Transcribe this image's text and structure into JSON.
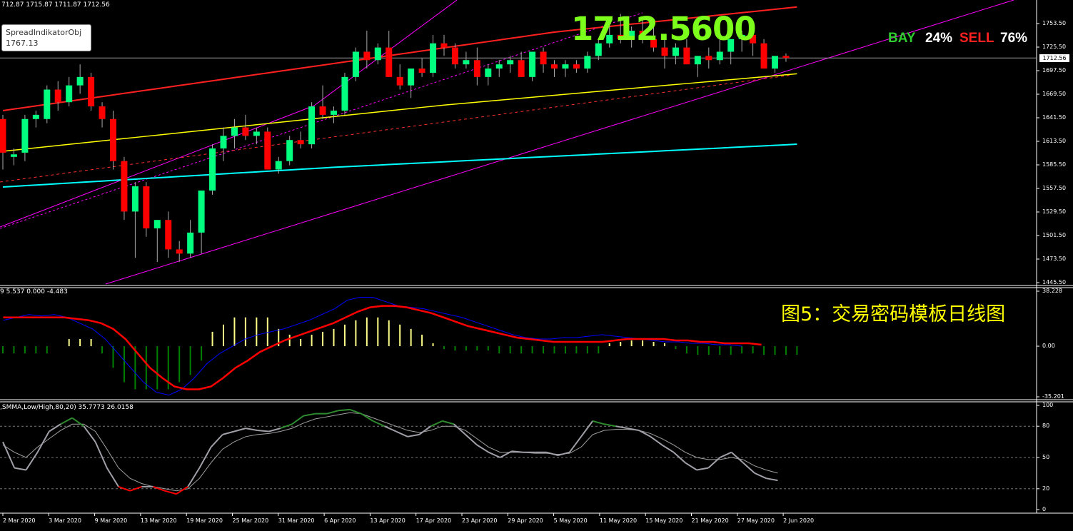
{
  "header": {
    "ohlc_text": "712.87 1715.87 1711.87 1712.56",
    "object_name": "SpreadIndikatorObj",
    "object_value": "1767.13",
    "big_price": "1712.5600",
    "bay_label": "BAY",
    "bay_pct": "24%",
    "sell_label": "SELL",
    "sell_pct": "76%",
    "current_price_tag": "1712.56",
    "figure_title": "图5：交易密码模板日线图"
  },
  "colors": {
    "background": "#000000",
    "bull_candle": "#00ff7f",
    "bear_candle": "#ff0000",
    "ma_yellow": "#ffff00",
    "ma_cyan": "#00ffff",
    "ma_red": "#ff2020",
    "channel": "#ff00ff",
    "macd_line": "#ff0000",
    "signal_line": "#0000ff",
    "hist_pos": "#ffff88",
    "hist_neg": "#008000",
    "stoch_main": "#a0a0a8",
    "stoch_signal": "#a0a0a0",
    "stoch_overbought": "#2e8b2e",
    "stoch_oversold": "#ff0000"
  },
  "chart_data": [
    {
      "type": "candlestick",
      "x_labels": [
        "2 Mar 2020",
        "3 Mar 2020",
        "9 Mar 2020",
        "13 Mar 2020",
        "19 Mar 2020",
        "25 Mar 2020",
        "31 Mar 2020",
        "6 Apr 2020",
        "13 Apr 2020",
        "17 Apr 2020",
        "23 Apr 2020",
        "29 Apr 2020",
        "5 May 2020",
        "11 May 2020",
        "15 May 2020",
        "21 May 2020",
        "27 May 2020",
        "2 Jun 2020"
      ],
      "y_ticks": [
        "1753.50",
        "1725.50",
        "1697.50",
        "1669.50",
        "1641.50",
        "1613.50",
        "1585.50",
        "1557.50",
        "1529.50",
        "1501.50",
        "1473.50",
        "1445.50"
      ],
      "ylim": [
        1445.5,
        1778
      ],
      "candles": [
        [
          1640,
          1645,
          1580,
          1600
        ],
        [
          1595,
          1605,
          1585,
          1598
        ],
        [
          1600,
          1645,
          1590,
          1640
        ],
        [
          1640,
          1650,
          1630,
          1645
        ],
        [
          1640,
          1680,
          1635,
          1675
        ],
        [
          1675,
          1685,
          1650,
          1660
        ],
        [
          1660,
          1690,
          1655,
          1680
        ],
        [
          1680,
          1705,
          1670,
          1690
        ],
        [
          1690,
          1695,
          1650,
          1655
        ],
        [
          1655,
          1660,
          1630,
          1640
        ],
        [
          1640,
          1650,
          1580,
          1590
        ],
        [
          1590,
          1595,
          1520,
          1530
        ],
        [
          1530,
          1565,
          1475,
          1560
        ],
        [
          1560,
          1565,
          1500,
          1510
        ],
        [
          1510,
          1520,
          1470,
          1520
        ],
        [
          1520,
          1530,
          1475,
          1485
        ],
        [
          1485,
          1495,
          1470,
          1480
        ],
        [
          1480,
          1520,
          1475,
          1505
        ],
        [
          1505,
          1525,
          1480,
          1555
        ],
        [
          1555,
          1610,
          1550,
          1605
        ],
        [
          1605,
          1630,
          1590,
          1620
        ],
        [
          1620,
          1640,
          1605,
          1630
        ],
        [
          1630,
          1645,
          1615,
          1620
        ],
        [
          1620,
          1630,
          1610,
          1625
        ],
        [
          1625,
          1630,
          1580,
          1580
        ],
        [
          1580,
          1595,
          1575,
          1590
        ],
        [
          1590,
          1620,
          1585,
          1615
        ],
        [
          1615,
          1625,
          1605,
          1610
        ],
        [
          1610,
          1660,
          1605,
          1655
        ],
        [
          1655,
          1680,
          1640,
          1645
        ],
        [
          1645,
          1655,
          1635,
          1650
        ],
        [
          1650,
          1695,
          1645,
          1690
        ],
        [
          1690,
          1725,
          1685,
          1720
        ],
        [
          1720,
          1745,
          1700,
          1710
        ],
        [
          1710,
          1730,
          1705,
          1725
        ],
        [
          1725,
          1745,
          1690,
          1690
        ],
        [
          1690,
          1705,
          1675,
          1680
        ],
        [
          1680,
          1700,
          1665,
          1700
        ],
        [
          1700,
          1712,
          1690,
          1695
        ],
        [
          1695,
          1740,
          1690,
          1730
        ],
        [
          1730,
          1740,
          1715,
          1725
        ],
        [
          1725,
          1730,
          1700,
          1705
        ],
        [
          1705,
          1720,
          1700,
          1710
        ],
        [
          1710,
          1725,
          1680,
          1690
        ],
        [
          1690,
          1705,
          1680,
          1700
        ],
        [
          1700,
          1710,
          1690,
          1705
        ],
        [
          1705,
          1715,
          1695,
          1710
        ],
        [
          1710,
          1720,
          1690,
          1690
        ],
        [
          1690,
          1720,
          1685,
          1720
        ],
        [
          1720,
          1725,
          1695,
          1705
        ],
        [
          1705,
          1710,
          1690,
          1700
        ],
        [
          1700,
          1710,
          1690,
          1705
        ],
        [
          1705,
          1710,
          1695,
          1700
        ],
        [
          1700,
          1720,
          1695,
          1715
        ],
        [
          1715,
          1735,
          1710,
          1730
        ],
        [
          1730,
          1750,
          1725,
          1740
        ],
        [
          1740,
          1765,
          1730,
          1735
        ],
        [
          1735,
          1750,
          1725,
          1745
        ],
        [
          1745,
          1760,
          1730,
          1735
        ],
        [
          1735,
          1755,
          1720,
          1725
        ],
        [
          1725,
          1735,
          1700,
          1715
        ],
        [
          1715,
          1730,
          1705,
          1725
        ],
        [
          1725,
          1735,
          1705,
          1705
        ],
        [
          1705,
          1715,
          1690,
          1715
        ],
        [
          1715,
          1725,
          1700,
          1710
        ],
        [
          1710,
          1740,
          1705,
          1720
        ],
        [
          1720,
          1735,
          1705,
          1735
        ],
        [
          1735,
          1745,
          1720,
          1740
        ],
        [
          1740,
          1745,
          1715,
          1730
        ],
        [
          1730,
          1735,
          1700,
          1700
        ],
        [
          1700,
          1715,
          1695,
          1715
        ],
        [
          1715,
          1718,
          1708,
          1712.56
        ]
      ]
    },
    {
      "type": "line",
      "name": "MACD",
      "y_ticks": [
        "38.228",
        "0.00",
        "-35.201"
      ],
      "ylim": [
        -35.201,
        38.228
      ],
      "header_text": "9 5.537 0.000 -4.483",
      "macd_line": [
        20,
        20,
        20,
        20,
        20,
        20,
        19,
        18,
        16,
        12,
        5,
        -5,
        -15,
        -22,
        -28,
        -30,
        -30,
        -28,
        -22,
        -15,
        -10,
        -4,
        0,
        4,
        7,
        10,
        13,
        16,
        20,
        24,
        27,
        28,
        28,
        27,
        25,
        23,
        20,
        17,
        14,
        12,
        10,
        8,
        6,
        5,
        4,
        3,
        3,
        3,
        3,
        3,
        4,
        5,
        5,
        5,
        5,
        4,
        4,
        3,
        3,
        2,
        2,
        2,
        1
      ],
      "signal_line": [
        18,
        20,
        22,
        21,
        22,
        20,
        16,
        12,
        5,
        -5,
        -15,
        -25,
        -32,
        -34,
        -30,
        -22,
        -12,
        -5,
        0,
        5,
        8,
        10,
        12,
        15,
        18,
        22,
        26,
        32,
        34,
        34,
        31,
        28,
        27,
        26,
        24,
        22,
        20,
        17,
        14,
        11,
        8,
        6,
        5,
        5,
        6,
        6,
        7,
        8,
        7,
        6,
        5,
        4,
        3,
        3,
        2,
        2,
        1,
        1,
        0
      ],
      "histogram": [
        -5,
        -5,
        -5,
        -5,
        -5,
        0,
        5,
        5,
        5,
        -5,
        -15,
        -25,
        -30,
        -30,
        -30,
        -30,
        -25,
        -20,
        -10,
        10,
        15,
        20,
        20,
        20,
        20,
        12,
        8,
        5,
        8,
        10,
        12,
        15,
        18,
        20,
        20,
        18,
        15,
        12,
        8,
        2,
        -2,
        -3,
        -3,
        -3,
        -3,
        -5,
        -5,
        -5,
        -5,
        -5,
        -5,
        -5,
        -5,
        -5,
        -5,
        2,
        3,
        4,
        4,
        3,
        2,
        -2,
        -5,
        -6,
        -6,
        -6,
        -6,
        -5,
        -5,
        -6,
        -6,
        -6,
        -6
      ]
    },
    {
      "type": "line",
      "name": "SMMA,Low/High,80,20",
      "header_text": ",SMMA,Low/High,80,20) 35.7773 26.0158",
      "y_ticks": [
        "100",
        "80",
        "50",
        "20",
        "0"
      ],
      "ylim": [
        0,
        100
      ],
      "main": [
        65,
        40,
        38,
        55,
        75,
        82,
        88,
        80,
        65,
        40,
        22,
        18,
        22,
        22,
        18,
        15,
        22,
        40,
        60,
        72,
        75,
        78,
        76,
        75,
        78,
        82,
        90,
        92,
        92,
        95,
        96,
        92,
        85,
        80,
        75,
        70,
        72,
        80,
        85,
        82,
        72,
        62,
        55,
        50,
        56,
        55,
        55,
        55,
        52,
        55,
        70,
        85,
        82,
        80,
        78,
        76,
        70,
        62,
        55,
        45,
        38,
        40,
        50,
        55,
        45,
        35,
        30,
        28
      ],
      "signal": [
        62,
        55,
        50,
        60,
        68,
        76,
        82,
        82,
        75,
        58,
        40,
        30,
        25,
        22,
        20,
        18,
        20,
        30,
        45,
        58,
        65,
        70,
        72,
        73,
        75,
        78,
        83,
        87,
        89,
        91,
        93,
        92,
        88,
        84,
        80,
        76,
        74,
        76,
        80,
        80,
        76,
        68,
        60,
        55,
        55,
        55,
        54,
        54,
        53,
        54,
        60,
        72,
        76,
        77,
        77,
        76,
        73,
        68,
        62,
        55,
        50,
        48,
        48,
        50,
        48,
        42,
        38,
        35
      ]
    }
  ]
}
